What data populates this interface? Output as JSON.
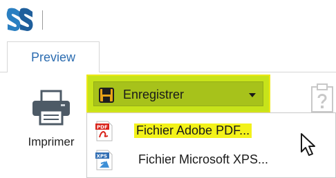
{
  "ribbon": {
    "tabs": [
      {
        "label": "Preview",
        "active": true
      }
    ]
  },
  "toolbar": {
    "print_label": "Imprimer",
    "save_label": "Enregistrer"
  },
  "save_menu": {
    "items": [
      {
        "label": "Fichier Adobe PDF...",
        "icon": "pdf-file-icon",
        "highlighted": true
      },
      {
        "label": "Fichier Microsoft XPS...",
        "icon": "xps-file-icon",
        "highlighted": false
      }
    ]
  },
  "colors": {
    "highlight_yellow": "#f3f21a",
    "save_button_green": "#a7c21b",
    "tab_text_blue": "#2b6cb0",
    "logo_blue": "#2a7fc1"
  }
}
